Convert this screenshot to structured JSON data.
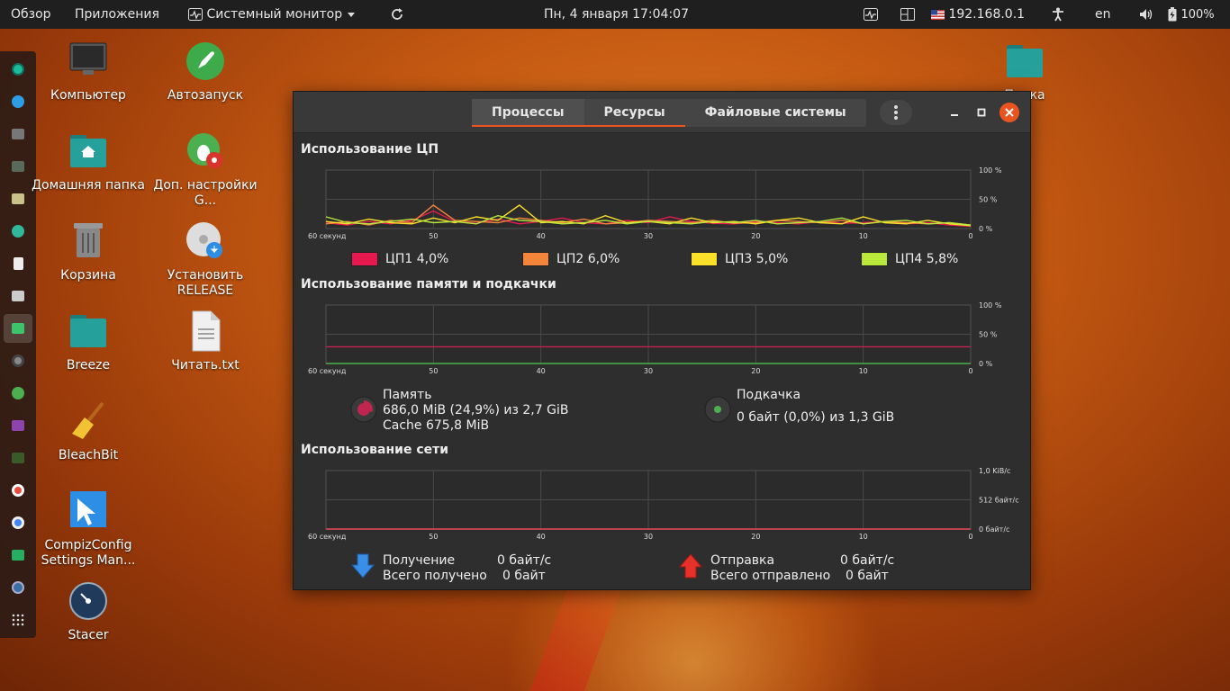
{
  "topbar": {
    "activities": "Обзор",
    "applications": "Приложения",
    "app_menu": "Системный монитор",
    "clock": "Пн, 4 января  17:04:07",
    "ip": "192.168.0.1",
    "keyboard": "en",
    "battery": "100%"
  },
  "desktop": {
    "computer": "Компьютер",
    "autostart": "Автозапуск",
    "home": "Домашняя папка",
    "tweaks": "Доп. настройки G...",
    "trash": "Корзина",
    "install": "Установить RELEASE",
    "breeze": "Breeze",
    "readme": "Читать.txt",
    "bleachbit": "BleachBit",
    "compiz": "CompizConfig Settings Man...",
    "stacer": "Stacer",
    "folder_right": "Папка"
  },
  "window": {
    "tabs": [
      "Процессы",
      "Ресурсы",
      "Файловые системы"
    ],
    "cpu": {
      "title": "Использование ЦП",
      "legend": [
        {
          "label": "ЦП1  4,0%",
          "color": "#e8194f"
        },
        {
          "label": "ЦП2  6,0%",
          "color": "#f5853a"
        },
        {
          "label": "ЦП3  5,0%",
          "color": "#fbe12a"
        },
        {
          "label": "ЦП4  5,8%",
          "color": "#b8e83a"
        }
      ]
    },
    "mem": {
      "title": "Использование памяти и подкачки",
      "mem_label": "Память",
      "mem_value": "686,0 MiB (24,9%) из 2,7 GiB",
      "mem_cache": "Cache 675,8 MiB",
      "swap_label": "Подкачка",
      "swap_value": "0 байт (0,0%) из 1,3 GiB"
    },
    "net": {
      "title": "Использование сети",
      "recv_label": "Получение",
      "recv_rate": "0 байт/с",
      "recv_total_label": "Всего получено",
      "recv_total": "0 байт",
      "send_label": "Отправка",
      "send_rate": "0 байт/с",
      "send_total_label": "Всего отправлено",
      "send_total": "0 байт"
    },
    "axis": {
      "x_ticks": [
        "60 секунд",
        "50",
        "40",
        "30",
        "20",
        "10",
        "0"
      ],
      "pct_ticks": [
        "100 %",
        "50 %",
        "0 %"
      ],
      "net_ticks": [
        "1,0 KiB/с",
        "512 байт/с",
        "0 байт/с"
      ]
    }
  },
  "chart_data": [
    {
      "type": "line",
      "title": "Использование ЦП",
      "xlim": [
        60,
        0
      ],
      "ylim": [
        0,
        100
      ],
      "x": [
        60,
        58,
        56,
        54,
        52,
        50,
        48,
        46,
        44,
        42,
        40,
        38,
        36,
        34,
        32,
        30,
        28,
        26,
        24,
        22,
        20,
        18,
        16,
        14,
        12,
        10,
        8,
        6,
        4,
        2,
        0
      ],
      "series": [
        {
          "name": "ЦП1",
          "color": "#e8194f",
          "values": [
            10,
            6,
            12,
            8,
            14,
            30,
            12,
            9,
            16,
            8,
            12,
            18,
            10,
            8,
            14,
            10,
            20,
            12,
            9,
            8,
            12,
            10,
            8,
            12,
            9,
            10,
            12,
            8,
            10,
            6,
            4
          ]
        },
        {
          "name": "ЦП2",
          "color": "#f5853a",
          "values": [
            8,
            12,
            6,
            14,
            10,
            40,
            14,
            12,
            10,
            18,
            14,
            10,
            16,
            8,
            10,
            14,
            12,
            10,
            14,
            9,
            10,
            14,
            12,
            10,
            14,
            8,
            12,
            10,
            8,
            10,
            6
          ]
        },
        {
          "name": "ЦП3",
          "color": "#fbe12a",
          "values": [
            12,
            8,
            16,
            10,
            8,
            18,
            10,
            20,
            14,
            40,
            10,
            12,
            8,
            22,
            10,
            12,
            8,
            18,
            10,
            12,
            8,
            14,
            18,
            10,
            8,
            20,
            10,
            8,
            14,
            8,
            5
          ]
        },
        {
          "name": "ЦП4",
          "color": "#b8e83a",
          "values": [
            20,
            10,
            8,
            12,
            16,
            10,
            12,
            8,
            22,
            14,
            12,
            8,
            10,
            14,
            8,
            12,
            10,
            8,
            12,
            10,
            14,
            8,
            10,
            12,
            18,
            8,
            12,
            14,
            8,
            10,
            5.8
          ]
        }
      ]
    },
    {
      "type": "line",
      "title": "Использование памяти и подкачки",
      "xlim": [
        60,
        0
      ],
      "ylim": [
        0,
        100
      ],
      "x": [
        60,
        0
      ],
      "series": [
        {
          "name": "Память",
          "color": "#c0254f",
          "values": [
            28.6,
            28.6
          ]
        },
        {
          "name": "Подкачка",
          "color": "#4caf50",
          "values": [
            0,
            0
          ]
        }
      ]
    },
    {
      "type": "line",
      "title": "Использование сети",
      "xlim": [
        60,
        0
      ],
      "ylim": [
        0,
        1024
      ],
      "x": [
        60,
        0
      ],
      "series": [
        {
          "name": "Получение",
          "color": "#3a8ee6",
          "values": [
            0,
            0
          ]
        },
        {
          "name": "Отправка",
          "color": "#e63a3a",
          "values": [
            0,
            0
          ]
        }
      ]
    }
  ]
}
